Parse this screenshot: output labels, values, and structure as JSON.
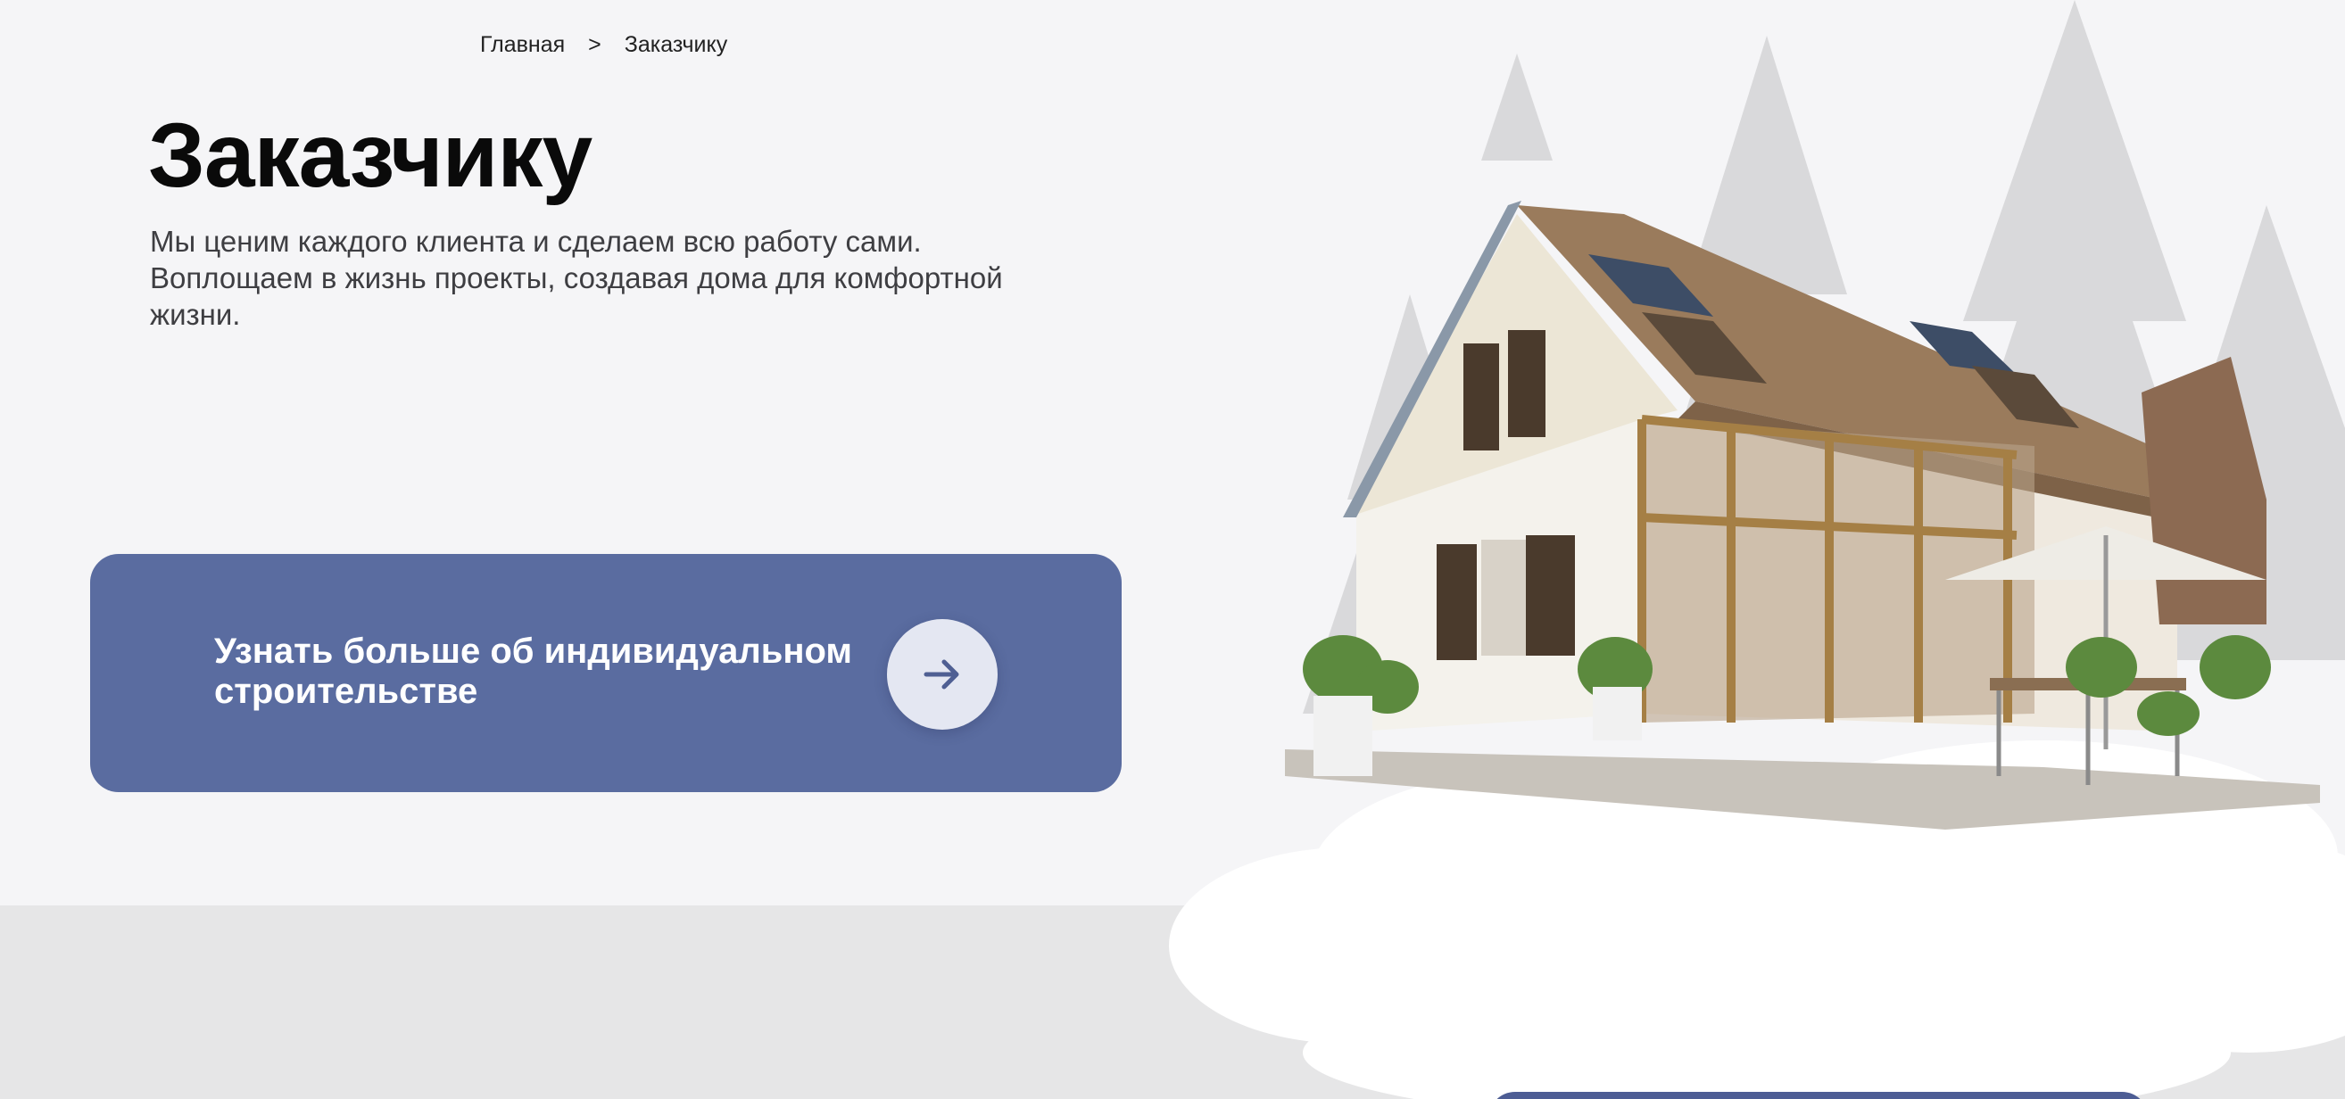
{
  "breadcrumb": {
    "items": [
      "Главная",
      "Заказчику"
    ],
    "separator": ">"
  },
  "page": {
    "title": "Заказчику",
    "subtitle": "Мы ценим каждого клиента и сделаем всю работу сами. Воплощаем в жизнь проекты, создавая дома для комфортной жизни."
  },
  "cta": {
    "label": "Узнать больше об индивидуальном строительстве",
    "arrow_icon": "arrow-right-icon"
  },
  "colors": {
    "background": "#f5f5f7",
    "bottom_band": "#e6e6e7",
    "accent": "#5a6ca0",
    "accent_dark": "#4d5d94",
    "title": "#0a0a0a",
    "text": "#3e3e42"
  }
}
